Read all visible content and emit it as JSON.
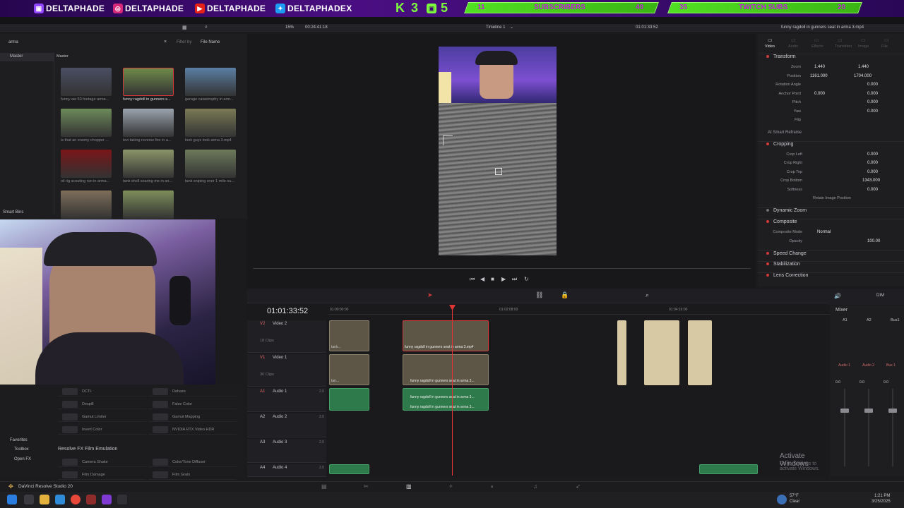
{
  "banner": {
    "social1": "DELTAPHADE",
    "social2": "DELTAPHADE",
    "social3": "DELTAPHADE",
    "social4": "DELTAPHADEX",
    "k3": "K",
    "k3num": "3",
    "pnum": "5",
    "sub_cur": "11",
    "sub_label": "SUBSCRIBERS",
    "sub_goal": "40",
    "tw_cur": "35",
    "tw_label": "TWITCH SUBS",
    "tw_goal": "20"
  },
  "toolbar": {
    "zoom": "15%",
    "timecode": "00:24:41:18",
    "timeline_name": "Timeline 1",
    "timecode2": "01:01:33:52",
    "clip_name": "funny ragdoll in gunners seat in arma 3.mp4"
  },
  "mediapool": {
    "search": "arma",
    "filter_label": "Filter by",
    "filter_value": "File Name",
    "bin_master": "Master",
    "bin_master2": "Master",
    "smart_bins": "Smart Bins",
    "clips": [
      "funny aw 50 footage arma...",
      "funny ragdoll in gunners s...",
      "garage catastrophy in arm...",
      "is that an enemy chopper ...",
      "levi taking reverse fire in a...",
      "look guys look arma 3.mp4",
      "oil rig scouting run in arma...",
      "tank shell soaring me in an...",
      "tank sniping over 1 mile ou...",
      "",
      ""
    ]
  },
  "inspector": {
    "tabs": [
      "Video",
      "Audio",
      "Effects",
      "Transition",
      "Image",
      "File"
    ],
    "transform": "Transform",
    "zoom_label": "Zoom",
    "zoom_x": "1.440",
    "zoom_y": "1.440",
    "pos_label": "Position",
    "pos_x": "1161.000",
    "pos_y": "1704.000",
    "rot_label": "Rotation Angle",
    "rot": "0.000",
    "anchor_label": "Anchor Point",
    "anchor_x": "0.000",
    "anchor_y": "0.000",
    "pitch_label": "Pitch",
    "pitch": "0.000",
    "yaw_label": "Yaw",
    "yaw": "0.000",
    "flip_label": "Flip",
    "smart": "AI Smart Reframe",
    "cropping": "Cropping",
    "crop_left_l": "Crop Left",
    "crop_left": "0.000",
    "crop_right_l": "Crop Right",
    "crop_right": "0.000",
    "crop_top_l": "Crop Top",
    "crop_top": "0.000",
    "crop_bottom_l": "Crop Bottom",
    "crop_bottom": "1343.000",
    "soft_l": "Softness",
    "soft": "0.000",
    "retain": "Retain Image Position",
    "dyn": "Dynamic Zoom",
    "composite": "Composite",
    "comp_mode_l": "Composite Mode",
    "comp_mode": "Normal",
    "opacity_l": "Opacity",
    "opacity": "100.00",
    "speed": "Speed Change",
    "stab": "Stabilization",
    "lens": "Lens Correction"
  },
  "fx": {
    "items": [
      "DCTL",
      "Dehaze",
      "Despill",
      "False Color",
      "Gamut Limiter",
      "Gamut Mapping",
      "Invert Color",
      "NVIDIA RTX Video HDR"
    ],
    "favorites": "Favorites",
    "toolbox": "Toolbox",
    "openfx": "Open FX",
    "emul": "Resolve FX Film Emulation",
    "items2": [
      "Camera Shake",
      "Color/Tone Diffuser",
      "Film Damage",
      "Film Grain"
    ]
  },
  "timeline": {
    "tc": "01:01:33:52",
    "ruler": [
      "01:00:00:00",
      "01:02:08:00",
      "01:04:16:00"
    ],
    "tracks": [
      {
        "id": "V2",
        "name": "Video 2",
        "clips": "18 Clips"
      },
      {
        "id": "V1",
        "name": "Video 1",
        "clips": "36 Clips"
      },
      {
        "id": "A1",
        "name": "Audio 1",
        "ch": "2.0"
      },
      {
        "id": "A2",
        "name": "Audio 2",
        "ch": "2.0"
      },
      {
        "id": "A3",
        "name": "Audio 3",
        "ch": "2.0"
      },
      {
        "id": "A4",
        "name": "Audio 4",
        "ch": "2.0"
      }
    ],
    "v2clip": "funny ragdoll in gunners seat in arma 3.mp4",
    "v1clip": "funny ragdoll in gunners seat in arma 3...",
    "a1clip": "funny ragdoll in gunners seat in arma 3...",
    "a1clip2": "funny ragdoll in gunners seat in arma 3...",
    "short": "tank...",
    "short2": "tan..."
  },
  "mixer": {
    "title": "Mixer",
    "ch": [
      "A1",
      "A2",
      "Bus1"
    ],
    "names": [
      "Audio 1",
      "Audio 2",
      "Bus 1"
    ],
    "vals": [
      "0.0",
      "0.0",
      "0.0"
    ],
    "dim": "DIM"
  },
  "status": {
    "app": "DaVinci Resolve Studio 20"
  },
  "watermark": {
    "l1": "Activate Windows",
    "l2": "Go to Settings to activate Windows."
  },
  "taskbar": {
    "temp": "57°F",
    "weather": "Clear",
    "time": "1:21 PM",
    "date": "3/25/2025"
  }
}
